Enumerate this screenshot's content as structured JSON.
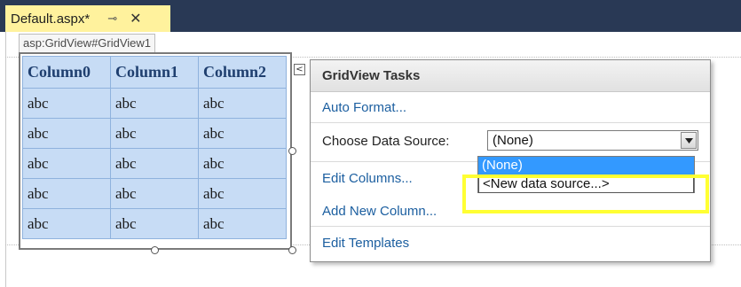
{
  "tab": {
    "title": "Default.aspx*",
    "pin_glyph": "⊸",
    "close_glyph": "✕"
  },
  "designer": {
    "tag_label": "asp:GridView#GridView1",
    "columns": [
      "Column0",
      "Column1",
      "Column2"
    ],
    "rows": [
      [
        "abc",
        "abc",
        "abc"
      ],
      [
        "abc",
        "abc",
        "abc"
      ],
      [
        "abc",
        "abc",
        "abc"
      ],
      [
        "abc",
        "abc",
        "abc"
      ],
      [
        "abc",
        "abc",
        "abc"
      ]
    ],
    "smart_tag_glyph": "<"
  },
  "tasks_panel": {
    "title": "GridView Tasks",
    "auto_format": "Auto Format...",
    "choose_label": "Choose Data Source:",
    "selected_source": "(None)",
    "edit_columns": "Edit Columns...",
    "add_new_column": "Add New Column...",
    "edit_templates": "Edit Templates",
    "options": [
      "(None)",
      "<New data source...>"
    ]
  },
  "colors": {
    "tab_bg": "#fff29d",
    "title_bar": "#293955",
    "highlight": "#ffff33",
    "selection": "#3399ff"
  }
}
